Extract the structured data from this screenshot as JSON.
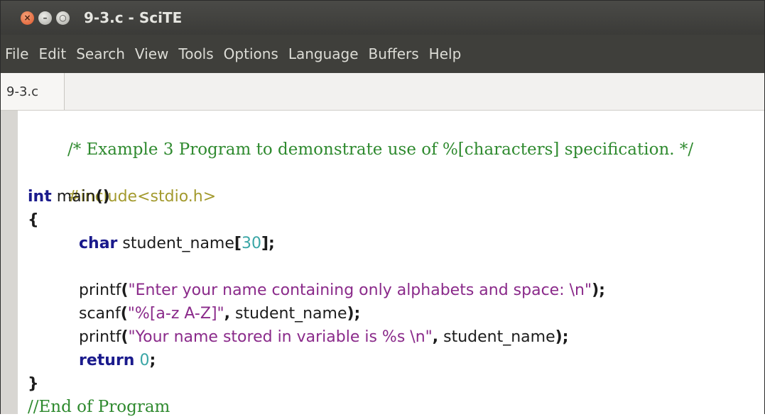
{
  "window": {
    "title": "9-3.c - SciTE"
  },
  "menu": [
    "File",
    "Edit",
    "Search",
    "View",
    "Tools",
    "Options",
    "Language",
    "Buffers",
    "Help"
  ],
  "tab": {
    "label": "9-3.c"
  },
  "code": {
    "comment_header": "/* Example 3 Program to demonstrate use of %[characters] specification. */",
    "include": "#include<stdio.h>",
    "main_kw": "int",
    "main_name": " main",
    "main_parens": "()",
    "open_brace": "{",
    "decl_kw": "char",
    "decl_name": " student_name",
    "decl_bracket_open": "[",
    "decl_size": "30",
    "decl_bracket_close": "];",
    "printf1_fn": "printf",
    "printf1_open": "(",
    "printf1_str": "\"Enter your name containing only alphabets and space: \\n\"",
    "printf1_close": ");",
    "scanf_fn": "scanf",
    "scanf_open": "(",
    "scanf_str": "\"%[a-z A-Z]\"",
    "scanf_comma": ",",
    "scanf_arg": " student_name",
    "scanf_close": ");",
    "printf2_fn": "printf",
    "printf2_open": "(",
    "printf2_str": "\"Your name stored in variable is %s \\n\"",
    "printf2_comma": ",",
    "printf2_arg": " student_name",
    "printf2_close": ");",
    "return_kw": "return",
    "return_val": " 0",
    "return_semi": ";",
    "close_brace": "}",
    "comment_footer": "//End of Program"
  }
}
